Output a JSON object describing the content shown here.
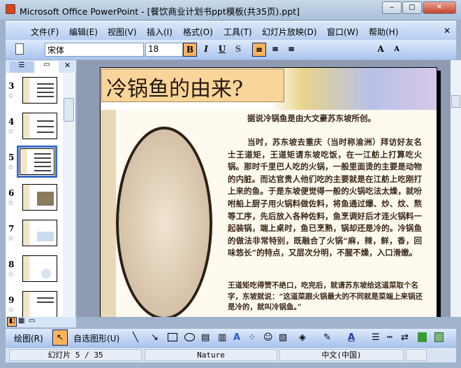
{
  "window": {
    "title": "Microsoft Office PowerPoint - [餐饮商业计划书ppt模板(共35页).ppt]",
    "minimize": "‒",
    "maximize": "▢",
    "close": "✕"
  },
  "menu": {
    "items": [
      "文件(F)",
      "编辑(E)",
      "视图(V)",
      "插入(I)",
      "格式(O)",
      "工具(T)",
      "幻灯片放映(D)",
      "窗口(W)",
      "帮助(H)"
    ],
    "close": "✕"
  },
  "toolbar": {
    "font": "宋体",
    "size": "18",
    "bold": "B",
    "italic": "I",
    "underline": "U",
    "shadow": "S",
    "grow": "A",
    "shrink": "A"
  },
  "pane": {
    "close": "✕",
    "slides": [
      {
        "num": "3"
      },
      {
        "num": "4"
      },
      {
        "num": "5",
        "selected": true
      },
      {
        "num": "6"
      },
      {
        "num": "7"
      },
      {
        "num": "8"
      },
      {
        "num": "9"
      }
    ],
    "star": "☆"
  },
  "slide": {
    "title": "冷锅鱼的由来?",
    "intro": "据说冷锅鱼是由大文豪苏东坡所创。",
    "body": "当时，苏东坡去重庆（当时称渝洲）拜访好友名士王道矩，王道矩请东坡吃饭，在一江舫上打算吃火锅。那时千里巴人吃的火锅，一般里面烫的主要是动物的内脏。而达官贵人他们吃的主要就是在江舫上吃刚打上来的鱼。于是东坡便觉得一般的火锅吃法太燥，就吩咐船上厨子用火锅料做佐料，将鱼通过爆、炒、炆、熬等工序，先后放入各种佐料，鱼烹调好后才连火锅料一起装锅，端上桌时，鱼已烹熟，锅却还是冷的。冷锅鱼的做法非常特别，既融合了火锅“麻，辣，鲜，香，回味悠长”的特点，又层次分明，不腥不燥，入口滑嫩。",
    "closing": "王道矩吃得赞不绝口，吃完后，就请苏东坡给这道菜取个名字，东坡就说：“这道菜跟火锅最大的不同就是菜端上来锅还是冷的，就叫冷锅鱼。”"
  },
  "drawing": {
    "draw": "绘图(R)",
    "autoshapes": "自选图形(U)"
  },
  "status": {
    "slide": "幻灯片 5 / 35",
    "design": "Nature",
    "language": "中文(中国)"
  }
}
